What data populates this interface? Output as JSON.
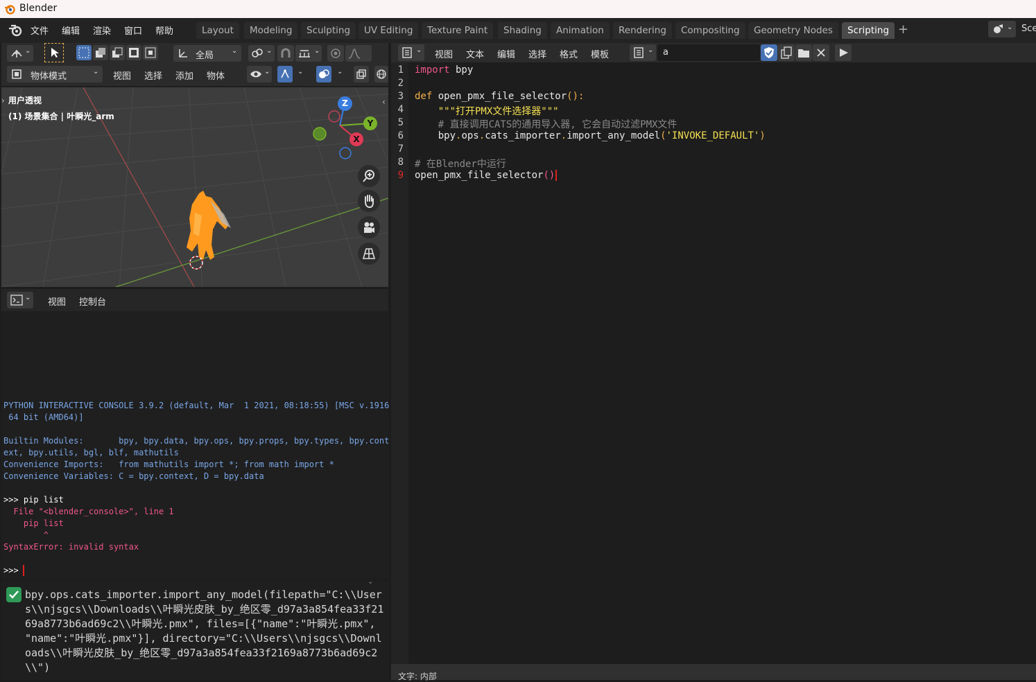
{
  "window": {
    "title": "Blender"
  },
  "menu": [
    "文件",
    "编辑",
    "渲染",
    "窗口",
    "帮助"
  ],
  "workspaces": [
    {
      "label": "Layout"
    },
    {
      "label": "Modeling"
    },
    {
      "label": "Sculpting"
    },
    {
      "label": "UV Editing"
    },
    {
      "label": "Texture Paint"
    },
    {
      "label": "Shading"
    },
    {
      "label": "Animation"
    },
    {
      "label": "Rendering"
    },
    {
      "label": "Compositing"
    },
    {
      "label": "Geometry Nodes"
    },
    {
      "label": "Scripting"
    }
  ],
  "active_workspace": "Scripting",
  "scene_label": "Sce",
  "viewport": {
    "transform_space": "全局",
    "mode": "物体模式",
    "menus": [
      "视图",
      "选择",
      "添加",
      "物体"
    ],
    "overlay_title": "用户透视",
    "overlay_collection": "(1) 场景集合 | 叶瞬光_arm",
    "gizmo": {
      "z": "Z",
      "y": "Y",
      "x": "X"
    }
  },
  "console": {
    "menus": [
      "视图",
      "控制台"
    ],
    "lines": [
      {
        "text": "PYTHON INTERACTIVE CONSOLE 3.9.2 (default, Mar  1 2021, 08:18:55) [MSC v.1916",
        "color": "#7aa6e6"
      },
      {
        "text": " 64 bit (AMD64)]",
        "color": "#7aa6e6"
      },
      {
        "text": "",
        "color": "#7aa6e6"
      },
      {
        "text": "Builtin Modules:       bpy, bpy.data, bpy.ops, bpy.props, bpy.types, bpy.cont",
        "color": "#7aa6e6"
      },
      {
        "text": "ext, bpy.utils, bgl, blf, mathutils",
        "color": "#7aa6e6"
      },
      {
        "text": "Convenience Imports:   from mathutils import *; from math import *",
        "color": "#7aa6e6"
      },
      {
        "text": "Convenience Variables: C = bpy.context, D = bpy.data",
        "color": "#7aa6e6"
      },
      {
        "text": "",
        "color": "#ffffff"
      },
      {
        "text": ">>> pip list",
        "color": "#ffffff"
      },
      {
        "text": "  File \"<blender_console>\", line 1",
        "color": "#f0578a"
      },
      {
        "text": "    pip list",
        "color": "#f0578a"
      },
      {
        "text": "        ^",
        "color": "#f0578a"
      },
      {
        "text": "SyntaxError: invalid syntax",
        "color": "#f0578a"
      },
      {
        "text": "",
        "color": "#ffffff"
      },
      {
        "text": ">>> ",
        "color": "#ffffff"
      }
    ]
  },
  "info": {
    "message": "bpy.ops.cats_importer.import_any_model(filepath=\"C:\\\\Users\\\\njsgcs\\\\Downloads\\\\叶瞬光皮肤_by_绝区零_d97a3a854fea33f2169a8773b6ad69c2\\\\叶瞬光.pmx\", files=[{\"name\":\"叶瞬光.pmx\", \"name\":\"叶瞬光.pmx\"}], directory=\"C:\\\\Users\\\\njsgcs\\\\Downloads\\\\叶瞬光皮肤_by_绝区零_d97a3a854fea33f2169a8773b6ad69c2\\\\\")"
  },
  "editor": {
    "menus": [
      "视图",
      "文本",
      "编辑",
      "选择",
      "格式",
      "模板"
    ],
    "text_name": "a",
    "status": "文字: 内部",
    "lines": [
      [
        {
          "t": "import",
          "c": "#f0578a"
        },
        {
          "t": " bpy",
          "c": "#e8e8e8"
        }
      ],
      [],
      [
        {
          "t": "def",
          "c": "#f0b04a"
        },
        {
          "t": " open_pmx_file_selector",
          "c": "#e8e8e8"
        },
        {
          "t": "():",
          "c": "#f0b04a"
        }
      ],
      [
        {
          "t": "    \"\"\"打开PMX文件选择器\"\"\"",
          "c": "#f5e052"
        }
      ],
      [
        {
          "t": "    # 直接调用CATS的通用导入器, 它会自动过滤PMX文件",
          "c": "#8a8a8a"
        }
      ],
      [
        {
          "t": "    bpy",
          "c": "#e8e8e8"
        },
        {
          "t": ".",
          "c": "#f0b04a"
        },
        {
          "t": "ops",
          "c": "#e8e8e8"
        },
        {
          "t": ".",
          "c": "#f0b04a"
        },
        {
          "t": "cats_importer",
          "c": "#e8e8e8"
        },
        {
          "t": ".",
          "c": "#f0b04a"
        },
        {
          "t": "import_any_model",
          "c": "#e8e8e8"
        },
        {
          "t": "(",
          "c": "#f0b04a"
        },
        {
          "t": "'INVOKE_DEFAULT'",
          "c": "#f5e052"
        },
        {
          "t": ")",
          "c": "#f0b04a"
        }
      ],
      [],
      [
        {
          "t": "# 在Blender中运行",
          "c": "#8a8a8a"
        }
      ],
      [
        {
          "t": "open_pmx_file_selector",
          "c": "#e8e8e8"
        },
        {
          "t": "()",
          "c": "#f0578a"
        }
      ]
    ]
  }
}
